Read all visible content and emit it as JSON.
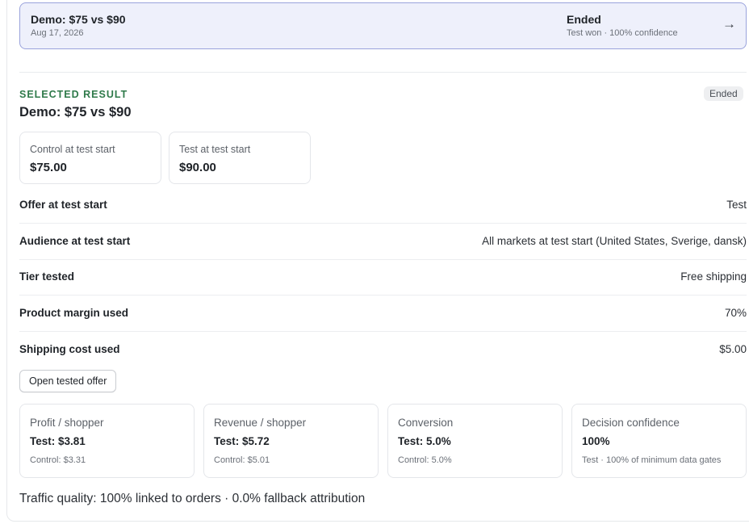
{
  "result_row": {
    "title": "Demo: $75 vs $90",
    "date": "Aug 17, 2026",
    "status": "Ended",
    "subtitle": "Test won · 100% confidence",
    "arrow": "→"
  },
  "selected": {
    "eyebrow": "SELECTED RESULT",
    "title": "Demo: $75 vs $90",
    "status_badge": "Ended"
  },
  "prices": [
    {
      "label": "Control at test start",
      "value": "$75.00"
    },
    {
      "label": "Test at test start",
      "value": "$90.00"
    }
  ],
  "details": [
    {
      "label": "Offer at test start",
      "value": "Test"
    },
    {
      "label": "Audience at test start",
      "value": "All markets at test start (United States, Sverige, dansk)"
    },
    {
      "label": "Tier tested",
      "value": "Free shipping"
    },
    {
      "label": "Product margin used",
      "value": "70%"
    },
    {
      "label": "Shipping cost used",
      "value": "$5.00"
    }
  ],
  "open_offer_button": "Open tested offer",
  "metrics": [
    {
      "label": "Profit / shopper",
      "value": "Test: $3.81",
      "sub": "Control: $3.31"
    },
    {
      "label": "Revenue / shopper",
      "value": "Test: $5.72",
      "sub": "Control: $5.01"
    },
    {
      "label": "Conversion",
      "value": "Test: 5.0%",
      "sub": "Control: 5.0%"
    },
    {
      "label": "Decision confidence",
      "value": "100%",
      "sub": "Test · 100% of minimum data gates"
    }
  ],
  "traffic_quality": "Traffic quality: 100% linked to orders · 0.0% fallback attribution"
}
